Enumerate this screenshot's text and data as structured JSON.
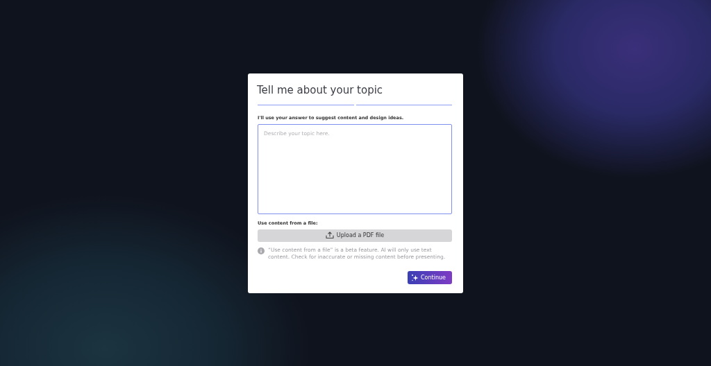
{
  "dialog": {
    "title": "Tell me about your topic",
    "steps": [
      {
        "active": true
      },
      {
        "active": true
      }
    ],
    "prompt_label": "I'll use your answer to suggest content and design ideas.",
    "topic_field": {
      "placeholder": "Describe your topic here."
    },
    "file_label": "Use content from a file:",
    "upload_button": "Upload a PDF file",
    "info_note": "“Use content from a file” is a beta feature. AI will only use text content. Check for inaccurate or missing content before presenting.",
    "continue_button": "Continue"
  }
}
